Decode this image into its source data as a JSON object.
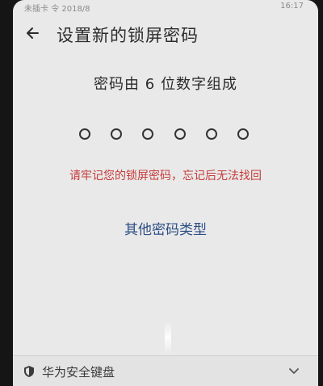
{
  "status_bar": {
    "left_text": "未插卡 令 2018/8",
    "right_text": "16:17"
  },
  "header": {
    "title": "设置新的锁屏密码",
    "back_icon": "arrow-left-icon"
  },
  "main": {
    "subtitle": "密码由 6 位数字组成",
    "pin_length": 6,
    "warning": "请牢记您的锁屏密码，忘记后无法找回",
    "other_types_link": "其他密码类型",
    "warning_color": "#c63a3a",
    "link_color": "#2d4f86"
  },
  "keyboard_bar": {
    "label": "华为安全键盘",
    "icon": "shield-icon",
    "collapse_icon": "chevron-down-icon"
  }
}
